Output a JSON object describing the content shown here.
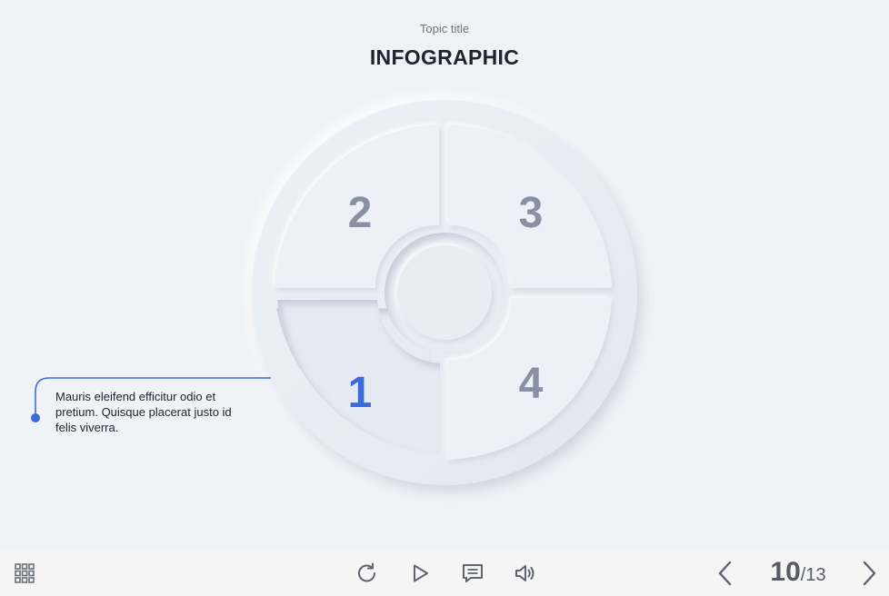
{
  "header": {
    "subtitle": "Topic title",
    "title": "INFOGRAPHIC"
  },
  "segments": [
    {
      "label": "1",
      "active": true
    },
    {
      "label": "2",
      "active": false
    },
    {
      "label": "3",
      "active": false
    },
    {
      "label": "4",
      "active": false
    }
  ],
  "callout": {
    "text": "Mauris eleifend efficitur odio et pretium. Quisque placerat justo id felis viverra."
  },
  "colors": {
    "accent": "#3b6ad9",
    "inactive_number": "#8a90a3",
    "background": "#eff2f7"
  },
  "toolbar": {
    "menu_icon": "grid-icon",
    "replay_icon": "replay-icon",
    "play_icon": "play-icon",
    "notes_icon": "chat-icon",
    "sound_icon": "speaker-icon",
    "prev_icon": "chevron-left-icon",
    "next_icon": "chevron-right-icon"
  },
  "pagination": {
    "current": "10",
    "total": "/13"
  }
}
